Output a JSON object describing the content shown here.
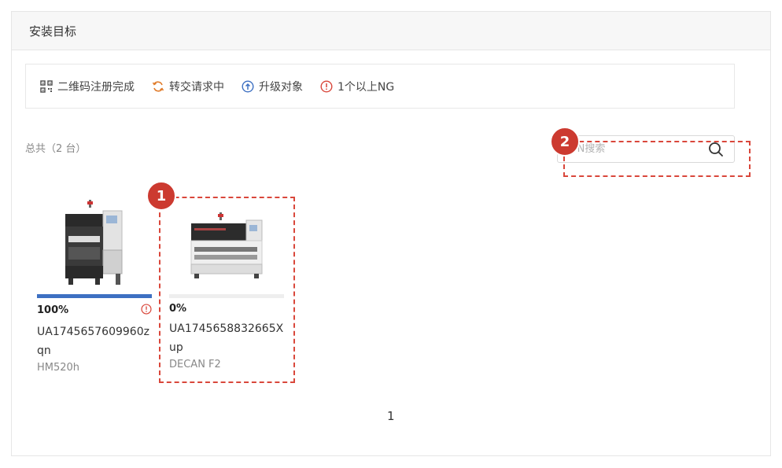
{
  "panel": {
    "title": "安装目标"
  },
  "legend": [
    {
      "icon": "qr-code-icon",
      "label": "二维码注册完成",
      "color": "#555555"
    },
    {
      "icon": "sync-icon",
      "label": "转交请求中",
      "color": "#e07b2a"
    },
    {
      "icon": "upgrade-icon",
      "label": "升级对象",
      "color": "#3d70c2"
    },
    {
      "icon": "warning-icon",
      "label": "1个以上NG",
      "color": "#d9473b"
    }
  ],
  "total_text": "总共（2 台）",
  "search": {
    "placeholder": "S/N搜索"
  },
  "badges": {
    "one": "1",
    "two": "2"
  },
  "devices": [
    {
      "progress_text": "100%",
      "progress": 1.0,
      "serial": "UA1745657609960zqn",
      "model": "HM520h",
      "ng_warning": true
    },
    {
      "progress_text": "0%",
      "progress": 0.0,
      "serial": "UA1745658832665Xup",
      "model": "DECAN F2",
      "ng_warning": false
    }
  ],
  "pagination": {
    "current": "1"
  },
  "colors": {
    "accent": "#3d70c2",
    "highlight": "#d9473b",
    "badge": "#cc3a30"
  }
}
